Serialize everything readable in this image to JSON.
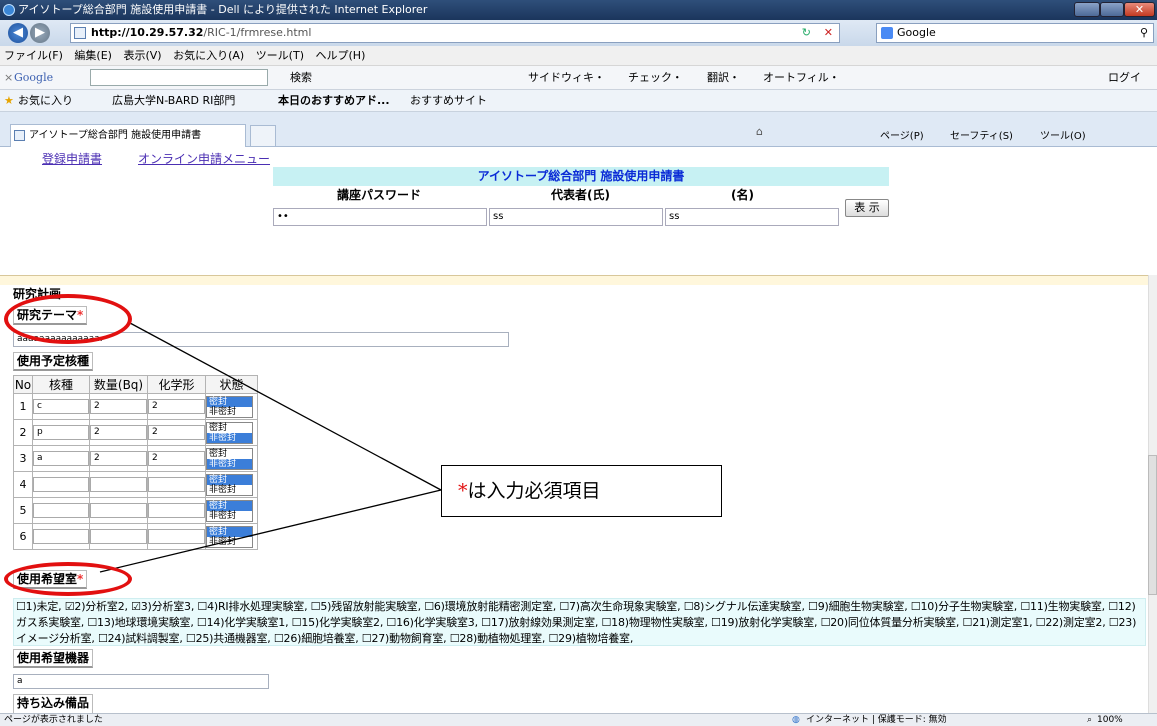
{
  "window": {
    "title": "アイソトープ総合部門 施設使用申請書 - Dell により提供された Internet Explorer",
    "close": "✕"
  },
  "address": {
    "url_host": "http://10.29.57.32",
    "url_path": "/RIC-1/frmrese.html",
    "search_engine": "Google"
  },
  "menu": [
    "ファイル(F)",
    "編集(E)",
    "表示(V)",
    "お気に入り(A)",
    "ツール(T)",
    "ヘルプ(H)"
  ],
  "google_toolbar": {
    "label": "Google",
    "search": "検索",
    "items": "サイドウィキ・",
    "check": "チェック・",
    "translate": "翻訳・",
    "autofill": "オートフィル・",
    "login": "ログイン・"
  },
  "favorites": {
    "label": "お気に入り",
    "item1": "広島大学N-BARD RI部門",
    "item2": "本日のおすすめアド...",
    "item3": "おすすめサイト"
  },
  "tab": {
    "title": "アイソトープ総合部門 施設使用申請書"
  },
  "commandbar": {
    "page": "ページ(P)",
    "safety": "セーフティ(S)",
    "tools": "ツール(O)"
  },
  "top": {
    "link1": "登録申請書",
    "link2": "オンライン申請メニュー",
    "form_title": "アイソトープ総合部門 施設使用申請書",
    "col_password": "講座パスワード",
    "col_rep": "代表者(氏)",
    "col_given": "(名)",
    "password_value": "••",
    "rep_value": "ss",
    "given_value": "ss",
    "show_button": "表 示"
  },
  "main": {
    "section": "研究計画",
    "theme_label": "研究テーマ",
    "required_mark": "*",
    "theme_value": "aaaaaaaaaaaaaaa.",
    "nuclide_label": "使用予定核種",
    "table_headers": [
      "No",
      "核種",
      "数量(Bq)",
      "化学形",
      "状態"
    ],
    "rows": [
      {
        "no": "1",
        "nuc": "c",
        "qty": "2",
        "form": "2",
        "s1": "密封",
        "s2": "非密封",
        "sel": 1
      },
      {
        "no": "2",
        "nuc": "p",
        "qty": "2",
        "form": "2",
        "s1": "密封",
        "s2": "非密封",
        "sel": 2
      },
      {
        "no": "3",
        "nuc": "a",
        "qty": "2",
        "form": "2",
        "s1": "密封",
        "s2": "非密封",
        "sel": 2
      },
      {
        "no": "4",
        "nuc": "",
        "qty": "",
        "form": "",
        "s1": "密封",
        "s2": "非密封",
        "sel": 1
      },
      {
        "no": "5",
        "nuc": "",
        "qty": "",
        "form": "",
        "s1": "密封",
        "s2": "非密封",
        "sel": 1
      },
      {
        "no": "6",
        "nuc": "",
        "qty": "",
        "form": "",
        "s1": "密封",
        "s2": "非密封",
        "sel": 1
      }
    ],
    "room_label": "使用希望室",
    "rooms_text": "☐1)未定, ☑2)分析室2, ☑3)分析室3, ☐4)RI排水処理実験室, ☐5)残留放射能実験室, ☐6)環境放射能精密測定室, ☐7)高次生命現象実験室, ☐8)シグナル伝達実験室, ☐9)細胞生物実験室, ☐10)分子生物実験室, ☐11)生物実験室, ☐12)ガス系実験室, ☐13)地球環境実験室, ☐14)化学実験室1, ☐15)化学実験室2, ☐16)化学実験室3, ☐17)放射線効果測定室, ☐18)物理物性実験室, ☐19)放射化学実験室, ☐20)同位体質量分析実験室, ☐21)測定室1, ☐22)測定室2, ☐23)イメージ分析室, ☐24)試料調製室, ☐25)共通機器室, ☐26)細胞培養室, ☐27)動物飼育室, ☐28)動植物処理室, ☐29)植物培養室,",
    "equip_label": "使用希望機器",
    "equip_value": "a",
    "bring_label": "持ち込み備品"
  },
  "callout": {
    "star": "*",
    "text": "は入力必須項目"
  },
  "status": {
    "left": "ページが表示されました",
    "zone": "インターネット | 保護モード: 無効",
    "zoom": "100%"
  }
}
